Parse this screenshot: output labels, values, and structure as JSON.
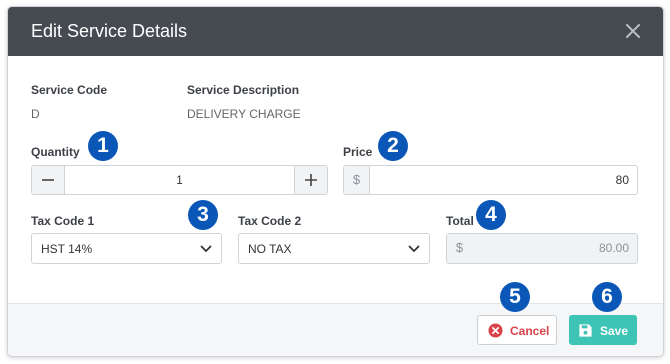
{
  "dialog": {
    "title": "Edit Service Details",
    "close_icon": "close-icon"
  },
  "service": {
    "code_label": "Service Code",
    "code_value": "D",
    "description_label": "Service Description",
    "description_value": "DELIVERY CHARGE"
  },
  "quantity": {
    "label": "Quantity",
    "value": "1",
    "decrement_icon": "minus-icon",
    "increment_icon": "plus-icon"
  },
  "price": {
    "label": "Price",
    "currency": "$",
    "value": "80"
  },
  "tax_code_1": {
    "label": "Tax Code 1",
    "selected": "HST 14%"
  },
  "tax_code_2": {
    "label": "Tax Code 2",
    "selected": "NO TAX"
  },
  "total": {
    "label": "Total",
    "currency": "$",
    "value": "80.00"
  },
  "footer": {
    "cancel_label": "Cancel",
    "save_label": "Save"
  },
  "markers": [
    "1",
    "2",
    "3",
    "4",
    "5",
    "6"
  ],
  "colors": {
    "header_bg": "#464b52",
    "marker_blue": "#0b57b8",
    "save_teal": "#3ec4b4",
    "cancel_red": "#d9434a"
  }
}
